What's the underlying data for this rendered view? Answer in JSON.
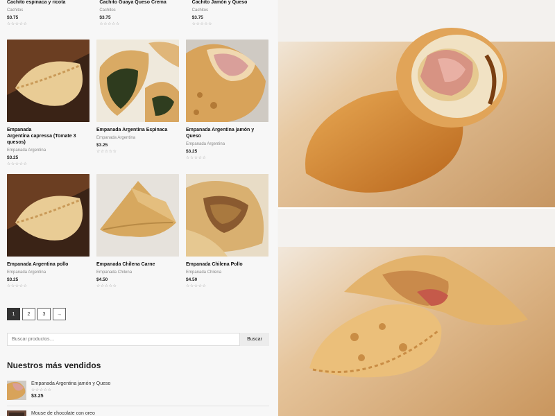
{
  "top_row": [
    {
      "name": "Cachito espinaca y ricota",
      "category": "Cachitos",
      "price": "$3.75",
      "stars": "☆☆☆☆☆"
    },
    {
      "name": "Cachito Guaya Queso Crema",
      "category": "Cachitos",
      "price": "$3.75",
      "stars": "☆☆☆☆☆"
    },
    {
      "name": "Cachito Jamón y Queso",
      "category": "Cachitos",
      "price": "$3.75",
      "stars": "☆☆☆☆☆"
    }
  ],
  "row2": [
    {
      "name_line1": "Empanada",
      "name_line2": "Argentina capressa (Tomate 3 quesos)",
      "category": "Empanada Argentina",
      "price": "$3.25",
      "stars": "☆☆☆☆☆"
    },
    {
      "name": "Empanada Argentina Espinaca",
      "category": "Empanada Argentina",
      "price": "$3.25",
      "stars": "☆☆☆☆☆"
    },
    {
      "name": "Empanada Argentina jamón y Queso",
      "category": "Empanada Argentina",
      "price": "$3.25",
      "stars": "☆☆☆☆☆"
    }
  ],
  "row3": [
    {
      "name": "Empanada Argentina pollo",
      "category": "Empanada Argentina",
      "price": "$3.25",
      "stars": "☆☆☆☆☆"
    },
    {
      "name": "Empanada Chilena Carne",
      "category": "Empanada Chilena",
      "price": "$4.50",
      "stars": "☆☆☆☆☆"
    },
    {
      "name": "Empanada Chilena Pollo",
      "category": "Empanada Chilena",
      "price": "$4.50",
      "stars": "☆☆☆☆☆"
    }
  ],
  "pagination": {
    "pages": [
      "1",
      "2",
      "3"
    ],
    "next": "→",
    "current": "1"
  },
  "search": {
    "placeholder": "Buscar productos…",
    "button": "Buscar"
  },
  "bestsellers": {
    "title": "Nuestros más vendidos",
    "items": [
      {
        "name": "Empanada Argentina jamón y Queso",
        "stars": "☆☆☆☆☆",
        "price": "$3.25"
      },
      {
        "name": "Mouse de chocolate con oreo"
      }
    ]
  }
}
